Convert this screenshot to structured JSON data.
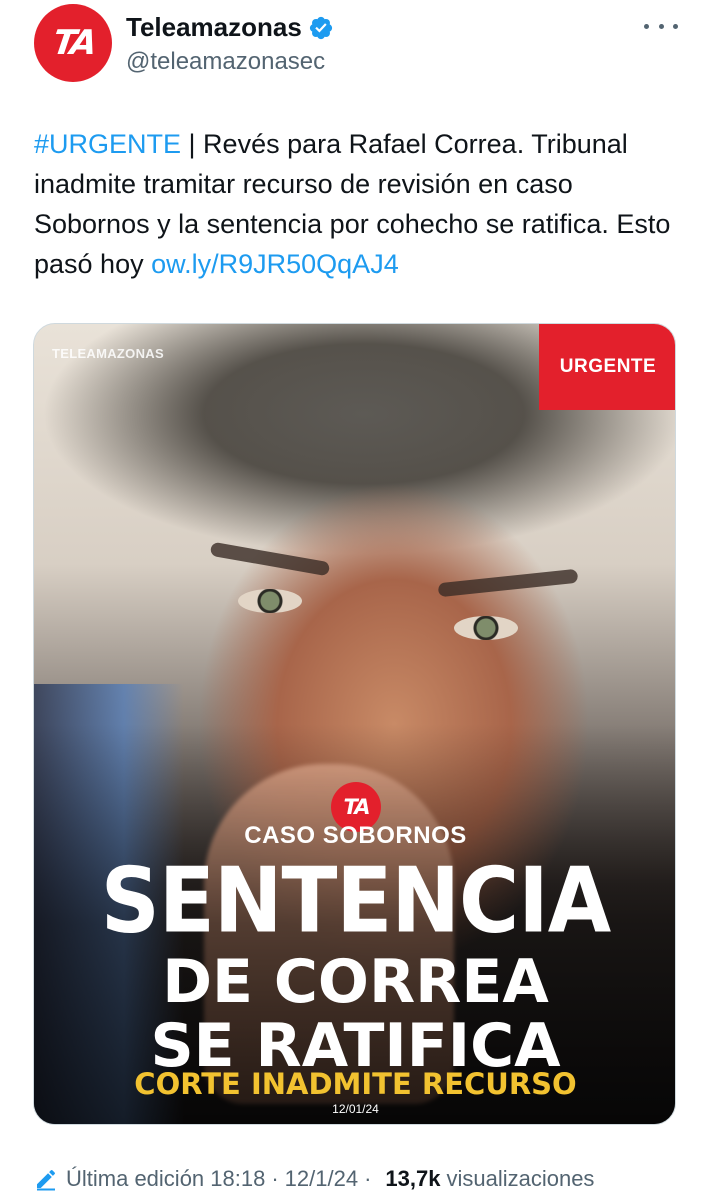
{
  "account": {
    "avatar_text": "TA",
    "display_name": "Teleamazonas",
    "handle": "@teleamazonasec",
    "verified": true
  },
  "tweet": {
    "hashtag": "#URGENTE",
    "text_1": " | Revés para Rafael Correa. Tribunal inadmite tramitar recurso de revisión en caso Sobornos y la sentencia por cohecho se ratifica. Esto pasó hoy ",
    "link": "ow.ly/R9JR50QqAJ4"
  },
  "media": {
    "watermark": "TELEAMAZONAS",
    "badge": "URGENTE",
    "logo_text": "TA",
    "kicker": "CASO SOBORNOS",
    "headline_1": "SENTENCIA",
    "headline_2": "DE CORREA",
    "headline_3": "SE RATIFICA",
    "subline": "CORTE INADMITE RECURSO",
    "date": "12/01/24"
  },
  "footer": {
    "edited_label": "Última edición 18:18",
    "date": "12/1/24",
    "views_count": "13,7k",
    "views_label": "visualizaciones"
  },
  "colors": {
    "brand_red": "#e3202c",
    "link_blue": "#1d9bf0",
    "headline_yellow": "#f2c230"
  }
}
